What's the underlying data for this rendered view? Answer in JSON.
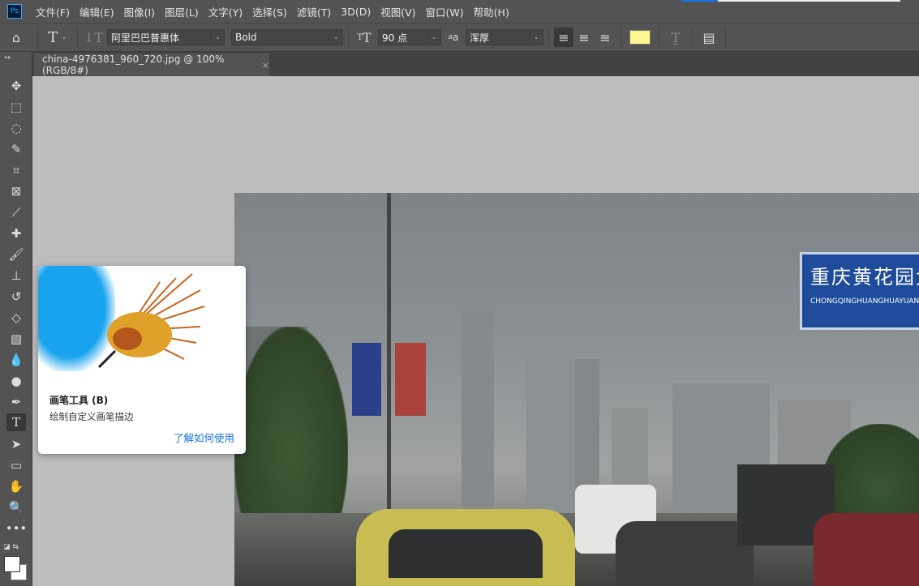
{
  "app": {
    "logo": "Ps"
  },
  "menu": [
    "文件(F)",
    "编辑(E)",
    "图像(I)",
    "图层(L)",
    "文字(Y)",
    "选择(S)",
    "滤镜(T)",
    "3D(D)",
    "视图(V)",
    "窗口(W)",
    "帮助(H)"
  ],
  "options": {
    "font_family": "阿里巴巴普惠体",
    "font_style": "Bold",
    "font_size": "90 点",
    "antialias": "浑厚",
    "text_color": "#fff68f"
  },
  "document_tab": {
    "title": "china-4976381_960_720.jpg @ 100%(RGB/8#)",
    "close": "×"
  },
  "tooltip": {
    "title": "画笔工具 (B)",
    "description": "绘制自定义画笔描边",
    "link": "了解如何使用"
  },
  "photo": {
    "sign_cn": "重庆黄花园大桥",
    "sign_en": "CHONGQINGHUANGHUAYUAN River B"
  },
  "colors": {
    "accent": "#1473e6",
    "canvas_bg": "#bdbdbd",
    "panel_bg": "#535353"
  }
}
